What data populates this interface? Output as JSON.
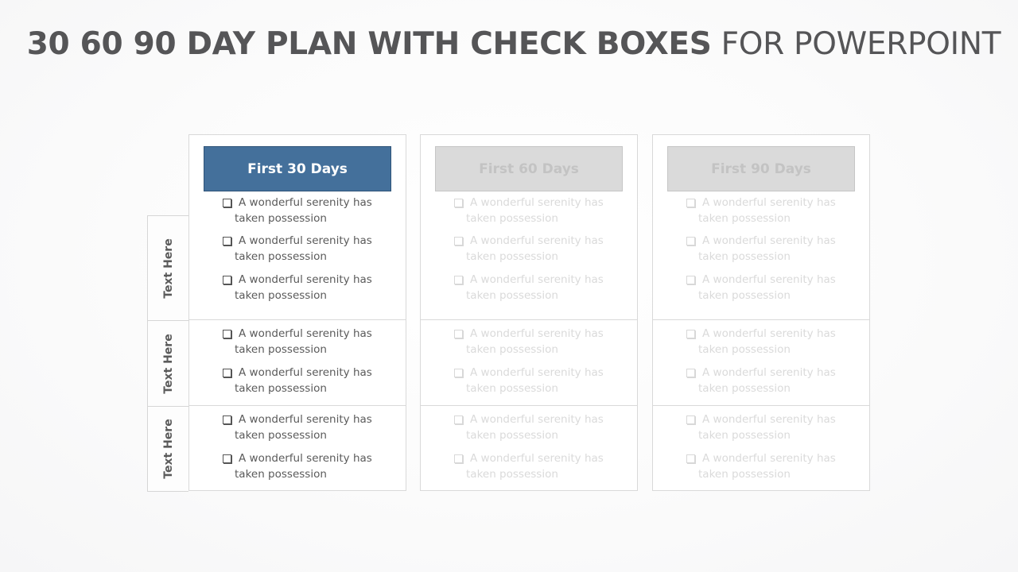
{
  "title": {
    "bold": "30 60 90 DAY PLAN WITH CHECK BOXES",
    "light": " FOR POWERPOINT"
  },
  "row_labels": [
    "Text Here",
    "Text Here",
    "Text Here"
  ],
  "columns": [
    {
      "header": "First 30 Days",
      "state": "active",
      "color": "#44709b",
      "rows": [
        [
          {
            "line1": "A wonderful serenity has",
            "line2": "taken possession",
            "checked": false
          },
          {
            "line1": "A wonderful serenity has",
            "line2": "taken possession",
            "checked": false
          },
          {
            "line1": "A wonderful serenity has",
            "line2": "taken possession",
            "checked": false
          }
        ],
        [
          {
            "line1": "A wonderful serenity has",
            "line2": "taken possession",
            "checked": false
          },
          {
            "line1": "A wonderful serenity has",
            "line2": "taken possession",
            "checked": false
          }
        ],
        [
          {
            "line1": "A wonderful serenity has",
            "line2": "taken possession",
            "checked": false
          },
          {
            "line1": "A wonderful serenity has",
            "line2": "taken possession",
            "checked": false
          }
        ]
      ]
    },
    {
      "header": "First 60 Days",
      "state": "faded",
      "color": "#dadada",
      "rows": [
        [
          {
            "line1": "A wonderful serenity has",
            "line2": "taken possession",
            "checked": false
          },
          {
            "line1": "A wonderful serenity has",
            "line2": "taken possession",
            "checked": false
          },
          {
            "line1": "A wonderful serenity has",
            "line2": "taken possession",
            "checked": false
          }
        ],
        [
          {
            "line1": "A wonderful serenity has",
            "line2": "taken possession",
            "checked": false
          },
          {
            "line1": "A wonderful serenity has",
            "line2": "taken possession",
            "checked": false
          }
        ],
        [
          {
            "line1": "A wonderful serenity has",
            "line2": "taken possession",
            "checked": false
          },
          {
            "line1": "A wonderful serenity has",
            "line2": "taken possession",
            "checked": false
          }
        ]
      ]
    },
    {
      "header": "First 90 Days",
      "state": "faded",
      "color": "#dadada",
      "rows": [
        [
          {
            "line1": "A wonderful serenity has",
            "line2": "taken possession",
            "checked": false
          },
          {
            "line1": "A wonderful serenity has",
            "line2": "taken possession",
            "checked": false
          },
          {
            "line1": "A wonderful serenity has",
            "line2": "taken possession",
            "checked": false
          }
        ],
        [
          {
            "line1": "A wonderful serenity has",
            "line2": "taken possession",
            "checked": false
          },
          {
            "line1": "A wonderful serenity has",
            "line2": "taken possession",
            "checked": false
          }
        ],
        [
          {
            "line1": "A wonderful serenity has",
            "line2": "taken possession",
            "checked": false
          },
          {
            "line1": "A wonderful serenity has",
            "line2": "taken possession",
            "checked": false
          }
        ]
      ]
    }
  ]
}
